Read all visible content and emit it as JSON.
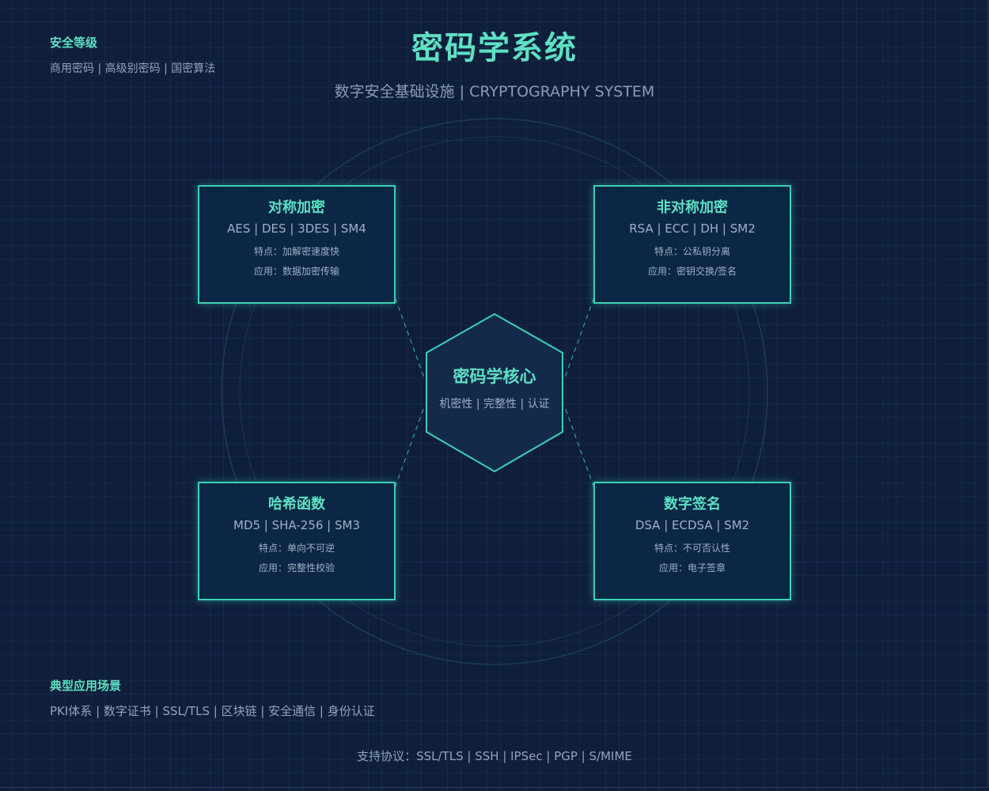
{
  "header": {
    "title": "密码学系统",
    "subtitle": "数字安全基础设施 | CRYPTOGRAPHY SYSTEM"
  },
  "security_level": {
    "heading": "安全等级",
    "text": "商用密码 | 高级别密码 | 国密算法"
  },
  "core": {
    "title": "密码学核心",
    "subtitle": "机密性 | 完整性 | 认证"
  },
  "cards": [
    {
      "title": "对称加密",
      "algorithms": "AES | DES | 3DES | SM4",
      "feature": "特点：加解密速度快",
      "application": "应用：数据加密传输"
    },
    {
      "title": "非对称加密",
      "algorithms": "RSA | ECC | DH | SM2",
      "feature": "特点：公私钥分离",
      "application": "应用：密钥交换/签名"
    },
    {
      "title": "哈希函数",
      "algorithms": "MD5 | SHA-256 | SM3",
      "feature": "特点：单向不可逆",
      "application": "应用：完整性校验"
    },
    {
      "title": "数字签名",
      "algorithms": "DSA | ECDSA | SM2",
      "feature": "特点：不可否认性",
      "application": "应用：电子签章"
    }
  ],
  "scenarios": {
    "heading": "典型应用场景",
    "text": "PKI体系 | 数字证书 | SSL/TLS | 区块链 | 安全通信 | 身份认证"
  },
  "footer": {
    "protocols": "支持协议：SSL/TLS | SSH | IPSec | PGP | S/MIME"
  },
  "colors": {
    "background": "#0f1e3b",
    "accent": "#5ee0c3",
    "card_border": "#3dcfb5",
    "card_fill": "#0b2745",
    "muted_text": "#93a3bb"
  }
}
